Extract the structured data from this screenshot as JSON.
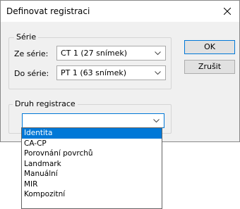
{
  "window": {
    "title": "Definovat registraci"
  },
  "series_group": {
    "legend": "Série",
    "from_label": "Ze série:",
    "from_value": "CT 1 (27 snímek)",
    "to_label": "Do série:",
    "to_value": "PT 1 (63 snímek)"
  },
  "buttons": {
    "ok": "OK",
    "cancel": "Zrušit"
  },
  "registration_type": {
    "legend": "Druh registrace",
    "value": "",
    "options": [
      "Identita",
      "CA-CP",
      "Porovnání povrchů",
      "Landmark",
      "Manuální",
      "MIR",
      "Kompozitní"
    ],
    "selected_index": 0
  },
  "colors": {
    "accent": "#0078d7",
    "dialog_bg": "#f0f0f0"
  },
  "icons": {
    "close": "close-icon",
    "dropdown": "chevron-down-icon"
  }
}
